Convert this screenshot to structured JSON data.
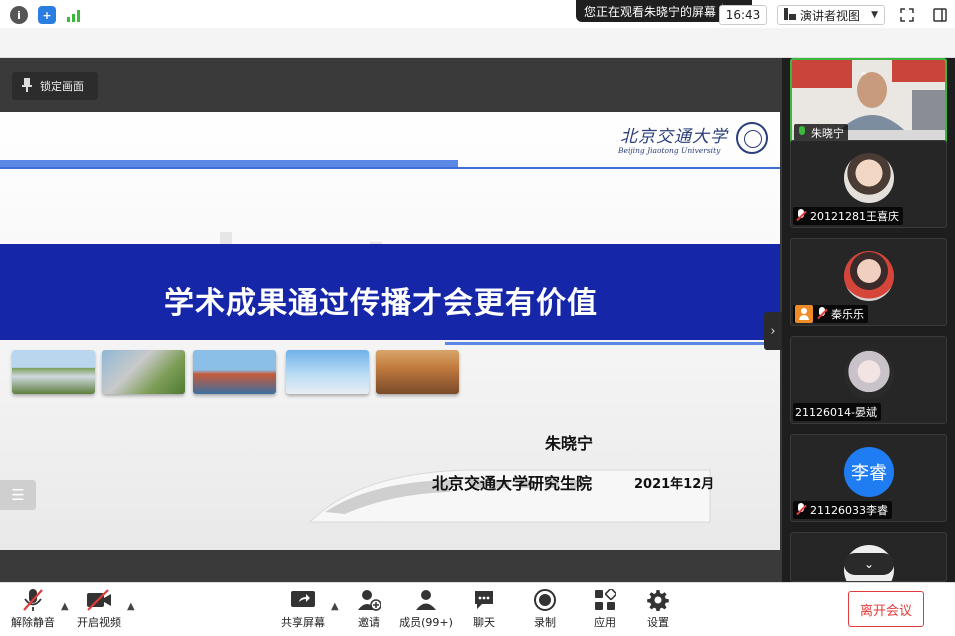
{
  "banner": {
    "text": "您正在观看朱晓宁的屏幕",
    "menu_glyph": "☰"
  },
  "inforow": {
    "clock": "16:43",
    "view_mode": "演讲者视图"
  },
  "share": {
    "lock_label": "锁定画面",
    "slide": {
      "logo_cn": "北京交通大学",
      "logo_en": "Beijing Jiaotong University",
      "title": "学术成果通过传播才会更有价值",
      "author": "朱晓宁",
      "affiliation": "北京交通大学研究生院",
      "date": "2021年12月"
    }
  },
  "participants": [
    {
      "name": "朱晓宁",
      "mic": "on",
      "type": "video"
    },
    {
      "name": "20121281王喜庆",
      "mic": "muted",
      "type": "photo"
    },
    {
      "name": "秦乐乐",
      "mic": "muted",
      "type": "photo",
      "host": true
    },
    {
      "name": "21126014-晏斌",
      "mic": "none",
      "type": "photo"
    },
    {
      "name": "21126033李睿",
      "mic": "muted",
      "type": "letter",
      "initials": "李睿"
    }
  ],
  "toolbar": {
    "unmute": "解除静音",
    "video": "开启视频",
    "share": "共享屏幕",
    "invite": "邀请",
    "members": "成员(99+)",
    "chat": "聊天",
    "record": "录制",
    "apps": "应用",
    "settings": "设置",
    "leave": "离开会议"
  },
  "colors": {
    "accent_blue": "#1626a8",
    "leave_red": "#e23b3b",
    "active_green": "#3cb83c"
  }
}
